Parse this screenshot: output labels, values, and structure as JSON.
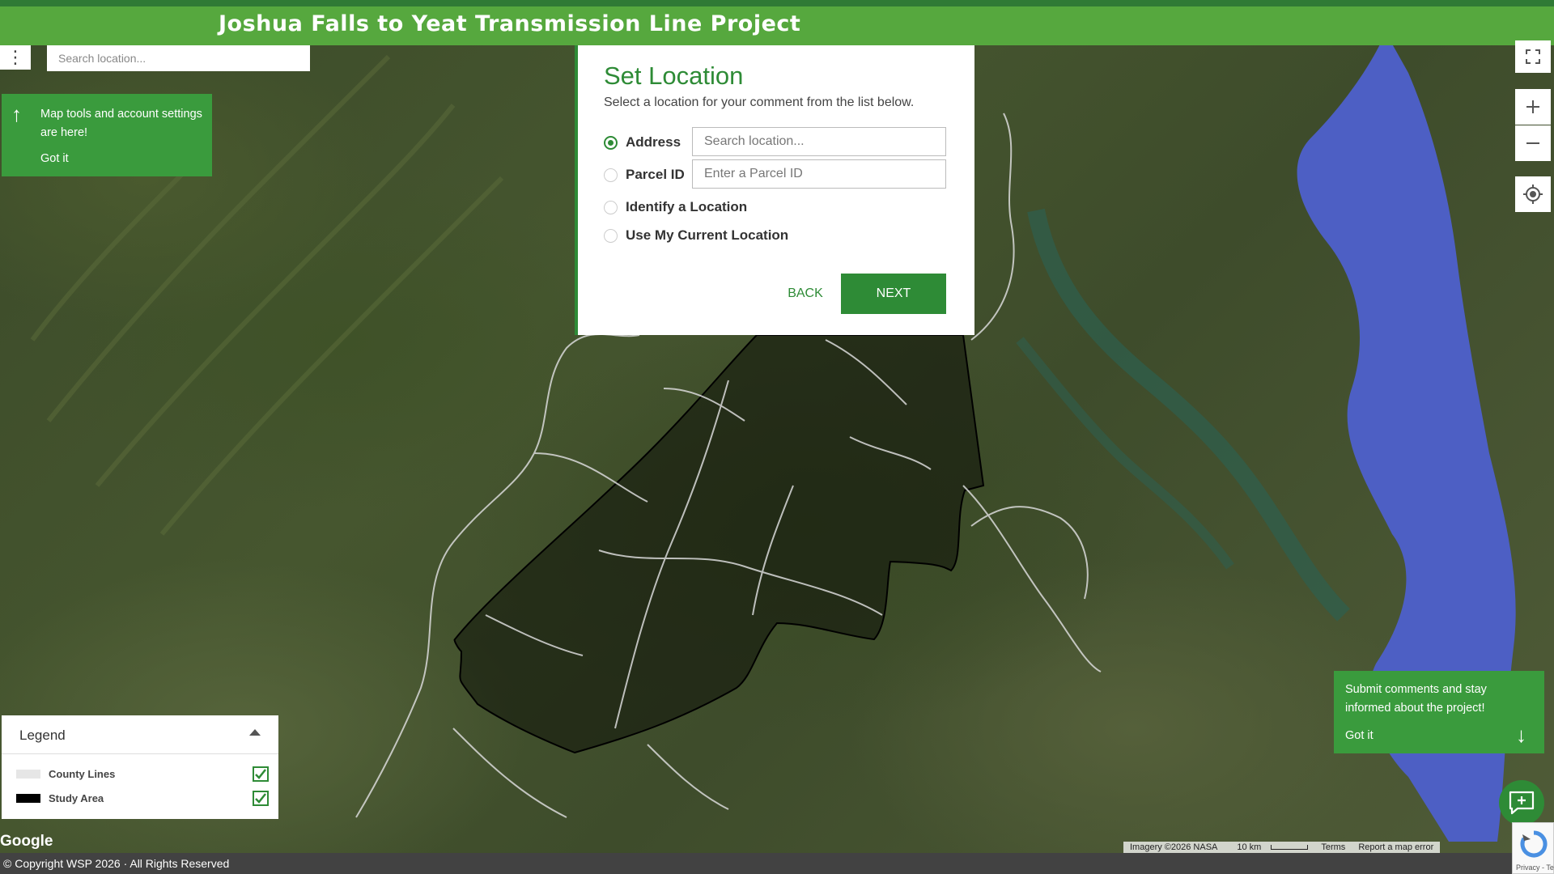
{
  "header": {
    "title": "Joshua Falls to Yeat Transmission Line Project"
  },
  "top_left": {
    "search_placeholder": "Search location...",
    "tip_text": "Map tools and account settings are here!",
    "tip_dismiss": "Got it"
  },
  "dialog": {
    "title": "Set Location",
    "subtitle": "Select a location for your comment from the list below.",
    "options": [
      {
        "label": "Address",
        "selected": true,
        "input_placeholder": "Search location..."
      },
      {
        "label": "Parcel ID",
        "selected": false,
        "input_placeholder": "Enter a Parcel ID"
      },
      {
        "label": "Identify a Location",
        "selected": false
      },
      {
        "label": "Use My Current Location",
        "selected": false
      }
    ],
    "back_label": "BACK",
    "next_label": "NEXT"
  },
  "map_controls": [
    "fullscreen-icon",
    "zoom-in-icon",
    "zoom-out-icon",
    "locate-icon"
  ],
  "legend": {
    "title": "Legend",
    "items": [
      {
        "label": "County Lines",
        "color": "#e6e6e6",
        "checked": true
      },
      {
        "label": "Study Area",
        "color": "#000000",
        "checked": true
      }
    ]
  },
  "submit_tip": {
    "text": "Submit comments and stay informed about the project!",
    "dismiss": "Got it"
  },
  "attribution": {
    "google": "Google",
    "imagery": "Imagery ©2026 NASA",
    "scale": "10 km",
    "terms": "Terms",
    "report": "Report a map error"
  },
  "footer": {
    "copyright": "© Copyright WSP 2026 · All Rights Reserved"
  },
  "recaptcha": {
    "text": "Privacy - Terms"
  },
  "colors": {
    "brand_green": "#2e8b36",
    "header_green": "#56a83e",
    "water_blue": "#4d5fc4"
  }
}
